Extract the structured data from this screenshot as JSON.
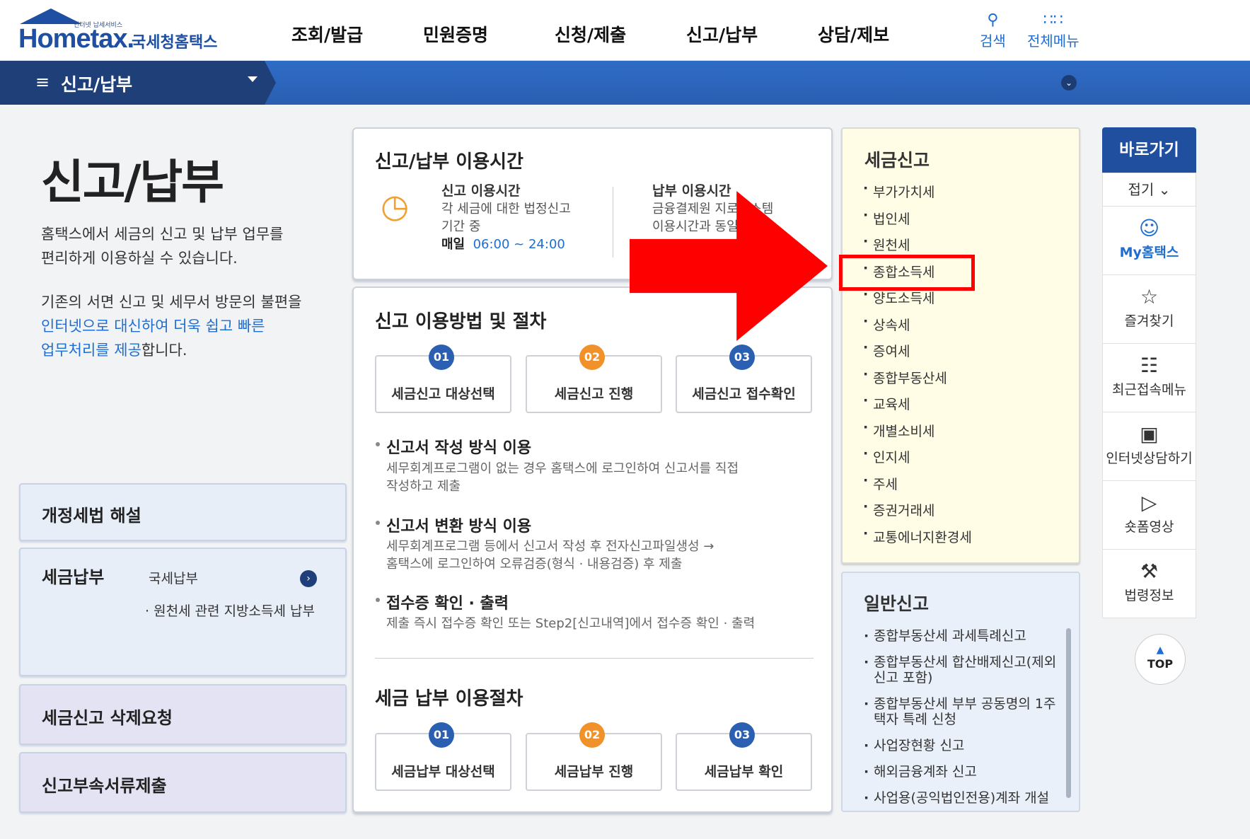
{
  "header": {
    "logo_small": "인터넷 납세서비스",
    "logo_main": "Hometax.",
    "logo_sub": "국세청홈택스",
    "nav": [
      "조회/발급",
      "민원증명",
      "신청/제출",
      "신고/납부",
      "상담/제보"
    ],
    "search_label": "검색",
    "all_menu_label": "전체메뉴"
  },
  "subbar": {
    "title": "신고/납부"
  },
  "intro": {
    "title": "신고/납부",
    "desc1_line1": "홈택스에서 세금의 신고 및 납부 업무를",
    "desc1_line2": "편리하게 이용하실 수 있습니다.",
    "desc2_line1": "기존의 서면 신고 및 세무서 방문의 불편을",
    "desc2_line2": "인터넷으로 대신하여 더욱 쉽고 빠른",
    "desc2_line3_blue": "업무처리를 제공",
    "desc2_line3_rest": "합니다."
  },
  "left_boxes": {
    "revised_law": "개정세법 해설",
    "tax_payment": "세금납부",
    "tax_payment_links": [
      "국세납부",
      "원천세 관련 지방소득세 납부"
    ],
    "delete_request": "세금신고 삭제요청",
    "attach_docs": "신고부속서류제출"
  },
  "hours": {
    "title": "신고/납부 이용시간",
    "report_title": "신고 이용시간",
    "report_line1": "각 세금에 대한 법정신고",
    "report_line2": "기간 중",
    "report_daily": "매일",
    "report_time": "06:00 ~ 24:00",
    "pay_title": "납부 이용시간",
    "pay_line1": "금융결제원 지로시스템",
    "pay_line2": "이용시간과 동일"
  },
  "procedure": {
    "title": "신고 이용방법 및 절차",
    "steps": [
      {
        "num": "01",
        "label": "세금신고 대상선택"
      },
      {
        "num": "02",
        "label": "세금신고 진행"
      },
      {
        "num": "03",
        "label": "세금신고 접수확인"
      }
    ],
    "method1_title": "신고서 작성 방식 이용",
    "method1_line1": "세무회계프로그램이 없는 경우 홈택스에 로그인하여 신고서를 직접",
    "method1_line2": "작성하고 제출",
    "method2_title": "신고서 변환 방식 이용",
    "method2_line1": "세무회계프로그램 등에서 신고서 작성 후 전자신고파일생성 →",
    "method2_line2": "홈택스에 로그인하여 오류검증(형식 · 내용검증) 후 제출",
    "method3_title": "접수증 확인 · 출력",
    "method3_line1": "제출 즉시 접수증 확인 또는 Step2[신고내역]에서 접수증 확인 · 출력",
    "pay_title": "세금 납부 이용절차",
    "pay_steps": [
      {
        "num": "01",
        "label": "세금납부 대상선택"
      },
      {
        "num": "02",
        "label": "세금납부 진행"
      },
      {
        "num": "03",
        "label": "세금납부 확인"
      }
    ]
  },
  "tax_report": {
    "title": "세금신고",
    "items": [
      "부가가치세",
      "법인세",
      "원천세",
      "종합소득세",
      "양도소득세",
      "상속세",
      "증여세",
      "종합부동산세",
      "교육세",
      "개별소비세",
      "인지세",
      "주세",
      "증권거래세",
      "교통에너지환경세"
    ]
  },
  "general_report": {
    "title": "일반신고",
    "items": [
      "종합부동산세 과세특례신고",
      "종합부동산세 합산배제신고(제외 신고 포함)",
      "종합부동산세 부부 공동명의 1주택자 특례 신청",
      "사업장현황 신고",
      "해외금융계좌 신고",
      "사업용(공익법인전용)계좌 개설"
    ]
  },
  "quick": {
    "title": "바로가기",
    "fold": "접기",
    "items": [
      {
        "label": "My홈택스",
        "icon": "user-icon"
      },
      {
        "label": "즐겨찾기",
        "icon": "star-icon"
      },
      {
        "label": "최근접속메뉴",
        "icon": "recent-icon"
      },
      {
        "label": "인터넷상담하기",
        "icon": "monitor-icon"
      },
      {
        "label": "숏폼영상",
        "icon": "play-icon"
      },
      {
        "label": "법령정보",
        "icon": "gavel-icon"
      }
    ],
    "top": "TOP"
  },
  "colors": {
    "brand": "#1e4fa3",
    "bar": "#2a5fb2",
    "highlight": "#ff0000",
    "tax_box_bg": "#fffde6"
  }
}
